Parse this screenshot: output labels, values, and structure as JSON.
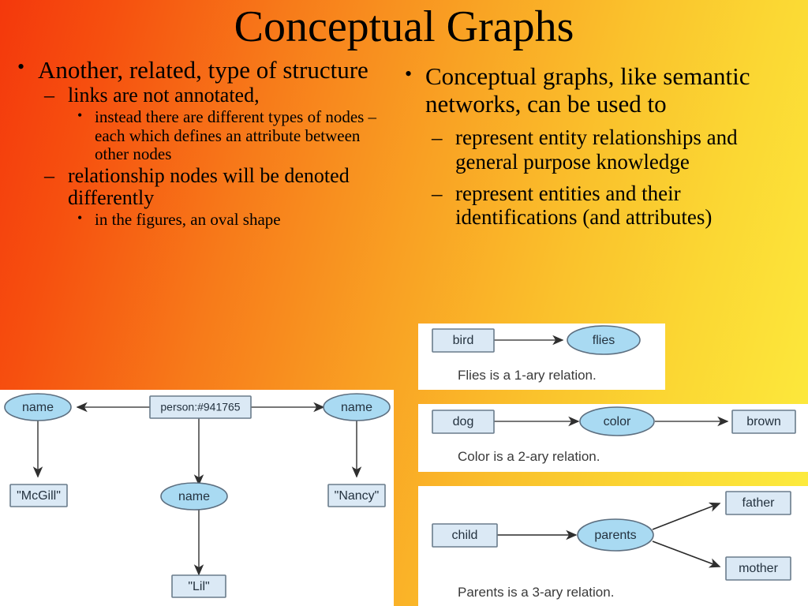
{
  "slide": {
    "title": "Conceptual Graphs",
    "background": {
      "from": "#f4380c",
      "to": "#fdee40"
    }
  },
  "left_column": {
    "bullets": [
      {
        "text": "Another, related, type of structure",
        "children": [
          {
            "text": "links are not annotated,",
            "children": [
              {
                "text": "instead there are different types of nodes – each which defines an attribute between other nodes"
              }
            ]
          },
          {
            "text": "relationship nodes will be denoted differently",
            "children": [
              {
                "text": "in the figures, an oval shape"
              }
            ]
          }
        ]
      }
    ]
  },
  "right_column": {
    "bullets": [
      {
        "text": "Conceptual graphs, like semantic networks, can be used to",
        "children": [
          {
            "text": "represent entity relationships and general purpose knowledge"
          },
          {
            "text": "represent entities and their identifications (and attributes)"
          }
        ]
      }
    ]
  },
  "diagrams": {
    "person": {
      "caption": "",
      "nodes": {
        "person": "person:#941765",
        "name_left": "name",
        "name_mid": "name",
        "name_right": "name",
        "mcgill": "\"McGill\"",
        "lil": "\"Lil\"",
        "nancy": "\"Nancy\""
      }
    },
    "flies": {
      "caption": "Flies is a 1-ary relation.",
      "nodes": {
        "entity": "bird",
        "relation": "flies"
      }
    },
    "color": {
      "caption": "Color is a 2-ary relation.",
      "nodes": {
        "entity": "dog",
        "relation": "color",
        "value": "brown"
      }
    },
    "parents": {
      "caption": "Parents is a 3-ary relation.",
      "nodes": {
        "entity": "child",
        "relation": "parents",
        "value1": "father",
        "value2": "mother"
      }
    }
  },
  "palette": {
    "box_fill": "#dbe9f5",
    "box_stroke": "#6a7c8c",
    "oval_fill": "#a9daf2",
    "oval_stroke": "#5d6f80",
    "panel_bg": "#ffffff",
    "text": "#000000"
  }
}
